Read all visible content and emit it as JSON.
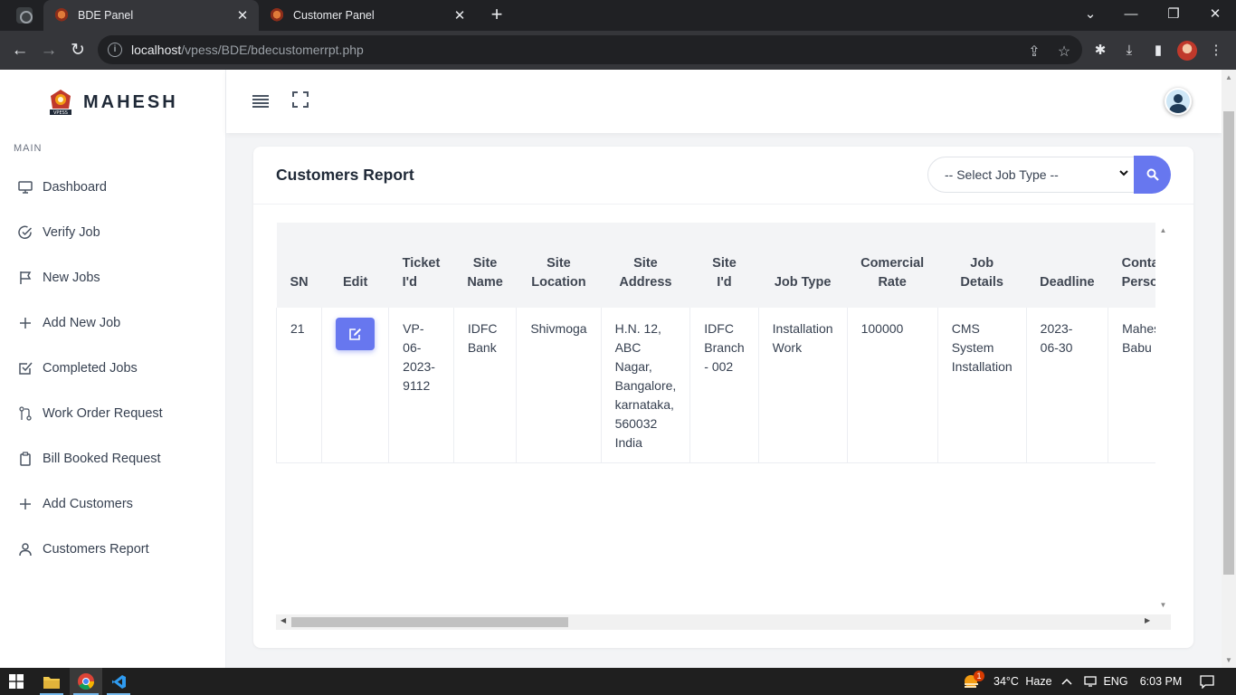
{
  "browser": {
    "tabs": [
      {
        "title": "BDE Panel",
        "active": true
      },
      {
        "title": "Customer Panel",
        "active": false
      }
    ],
    "url_host": "localhost",
    "url_path": "/vpess/BDE/bdecustomerrpt.php"
  },
  "sidebar": {
    "brand": "MAHESH",
    "logo_caption": "VPESS",
    "section": "MAIN",
    "items": [
      {
        "label": "Dashboard",
        "icon": "monitor-icon"
      },
      {
        "label": "Verify Job",
        "icon": "check-circle-icon"
      },
      {
        "label": "New Jobs",
        "icon": "flag-icon"
      },
      {
        "label": "Add New Job",
        "icon": "plus-icon"
      },
      {
        "label": "Completed Jobs",
        "icon": "check-square-icon"
      },
      {
        "label": "Work Order Request",
        "icon": "git-pull-request-icon"
      },
      {
        "label": "Bill Booked Request",
        "icon": "clipboard-icon"
      },
      {
        "label": "Add Customers",
        "icon": "plus-icon"
      },
      {
        "label": "Customers Report",
        "icon": "user-icon"
      }
    ]
  },
  "report": {
    "title": "Customers Report",
    "select_placeholder": "-- Select Job Type --",
    "columns": [
      [
        "SN"
      ],
      [
        "Edit"
      ],
      [
        "Ticket",
        "I'd"
      ],
      [
        "Site",
        "Name"
      ],
      [
        "Site",
        "Location"
      ],
      [
        "Site",
        "Address"
      ],
      [
        "Site",
        "I'd"
      ],
      [
        "Job Type"
      ],
      [
        "Comercial",
        "Rate"
      ],
      [
        "Job",
        "Details"
      ],
      [
        "Deadline"
      ],
      [
        "Contact",
        "Person"
      ]
    ],
    "rows": [
      {
        "sn": "21",
        "ticket": [
          "VP-",
          "06-",
          "2023-",
          "9112"
        ],
        "site_name": [
          "IDFC",
          "Bank"
        ],
        "site_location": [
          "Shivmoga"
        ],
        "site_address": [
          "H.N. 12,",
          "ABC",
          "Nagar,",
          "Bangalore,",
          "karnataka,",
          "560032",
          "India"
        ],
        "site_id": [
          "IDFC",
          "Branch",
          "- 002"
        ],
        "job_type": [
          "Installation",
          "Work"
        ],
        "rate": [
          "100000"
        ],
        "job_details": [
          "CMS",
          "System",
          "Installation"
        ],
        "deadline": [
          "2023-",
          "06-30"
        ],
        "contact": [
          "Mahesh",
          "Babu"
        ]
      }
    ]
  },
  "taskbar": {
    "weather_temp": "34°C",
    "weather_desc": "Haze",
    "weather_badge": "1",
    "language": "ENG",
    "time": "6:03 PM"
  },
  "colors": {
    "accent": "#6777ef",
    "sidebar_bg": "#ffffff",
    "page_bg": "#f3f4f6",
    "chrome_dark": "#202124"
  }
}
